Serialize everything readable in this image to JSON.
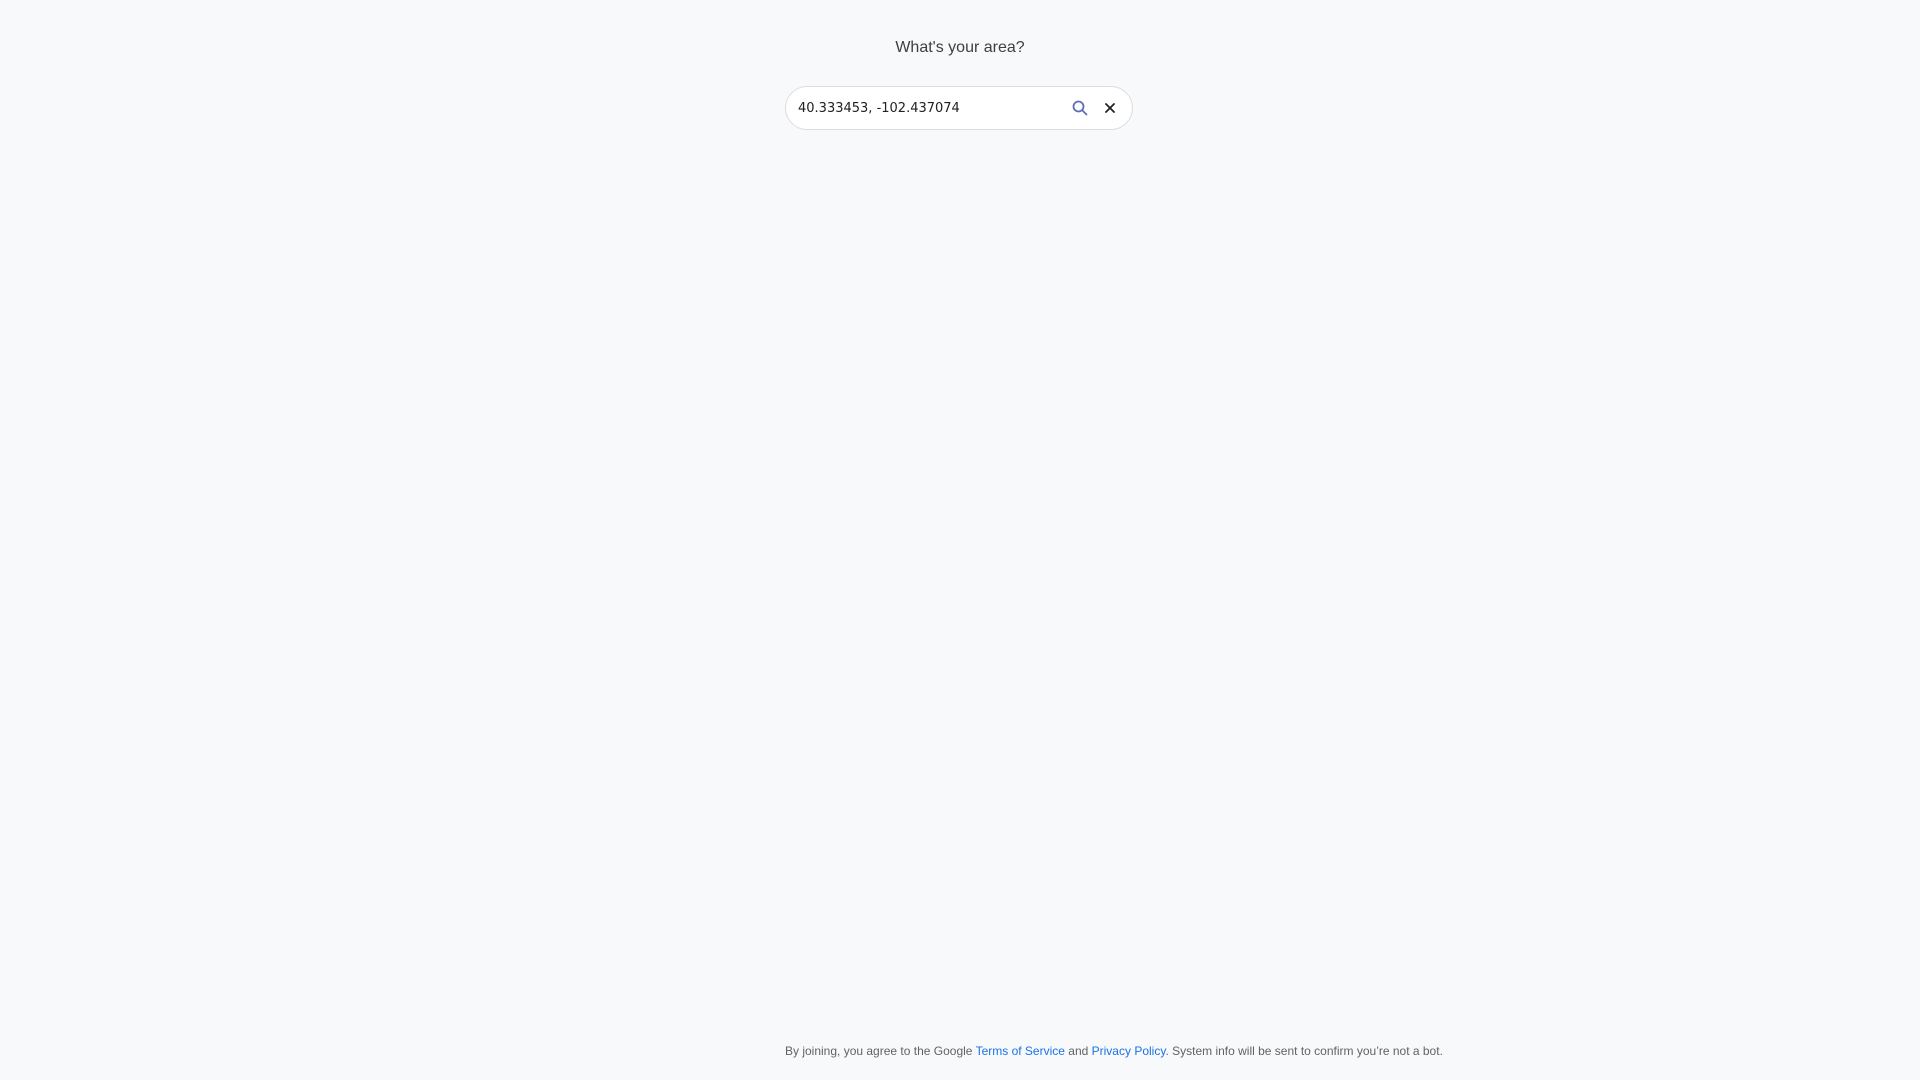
{
  "prompt": {
    "title": "What's your area?"
  },
  "search": {
    "value": "40.333453, -102.437074",
    "search_icon": "search-icon",
    "clear_icon": "close-icon",
    "icon_color": "#5f6fb5"
  },
  "footer": {
    "text_before": "By joining, you agree to the Google ",
    "terms_link": "Terms of Service",
    "text_middle": " and ",
    "privacy_link": "Privacy Policy",
    "text_after": ". System info will be sent to confirm you’re not a bot.",
    "link_color": "#1a73e8"
  }
}
